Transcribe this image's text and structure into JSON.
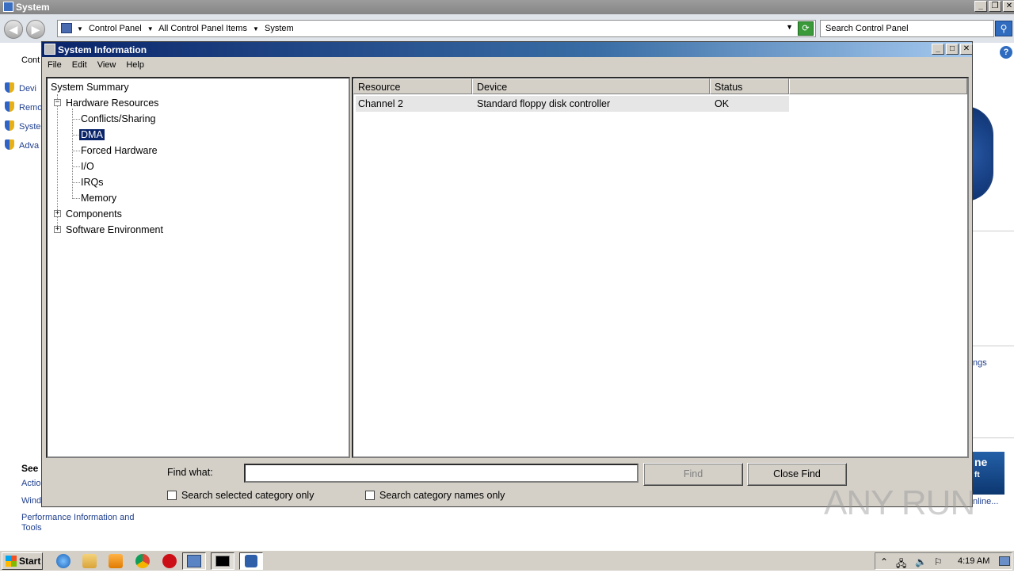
{
  "background_window": {
    "title": "System",
    "address": {
      "crumbs": [
        "Control Panel",
        "All Control Panel Items",
        "System"
      ]
    },
    "search_placeholder": "Search Control Panel",
    "left_items": [
      "Devi",
      "Remo",
      "Syste",
      "Adva"
    ],
    "left_top_text": "Cont",
    "see_also_heading": "See",
    "see_also_items": [
      "Actio",
      "Wind"
    ],
    "performance_link": "Performance Information and Tools",
    "right_text_1": "ngs",
    "right_text_2": "nline..."
  },
  "msinfo": {
    "title": "System Information",
    "menu": [
      "File",
      "Edit",
      "View",
      "Help"
    ],
    "tree": {
      "root": "System Summary",
      "hardware": "Hardware Resources",
      "hardware_children": [
        "Conflicts/Sharing",
        "DMA",
        "Forced Hardware",
        "I/O",
        "IRQs",
        "Memory"
      ],
      "components": "Components",
      "software": "Software Environment",
      "selected": "DMA"
    },
    "table": {
      "columns": [
        "Resource",
        "Device",
        "Status"
      ],
      "rows": [
        {
          "resource": "Channel 2",
          "device": "Standard floppy disk controller",
          "status": "OK"
        }
      ]
    },
    "find": {
      "label": "Find what:",
      "value": "",
      "find_button": "Find",
      "close_button": "Close Find",
      "check_selected": "Search selected category only",
      "check_names": "Search category names only"
    }
  },
  "taskbar": {
    "start": "Start",
    "clock": "4:19 AM"
  },
  "watermark": "ANY RUN"
}
